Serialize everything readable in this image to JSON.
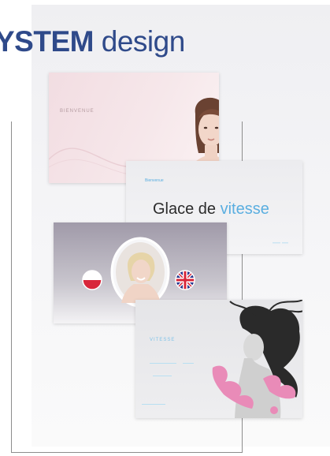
{
  "headline": {
    "bold": "YSTEM",
    "light": "design"
  },
  "cards": [
    {
      "caption": "BIENVENUE"
    },
    {
      "caption": "Bienvenue",
      "title_main": "Glace de ",
      "title_accent": "vitesse"
    },
    {
      "caption": ""
    },
    {
      "caption": "VITESSE"
    }
  ],
  "colors": {
    "headline": "#2f4a8a",
    "accent": "#5aaee0",
    "frame": "#8d8d8d",
    "flag_red": "#d8263a",
    "flag_blue": "#27348b"
  },
  "icons": [
    "poland-flag-icon",
    "uk-flag-icon"
  ]
}
